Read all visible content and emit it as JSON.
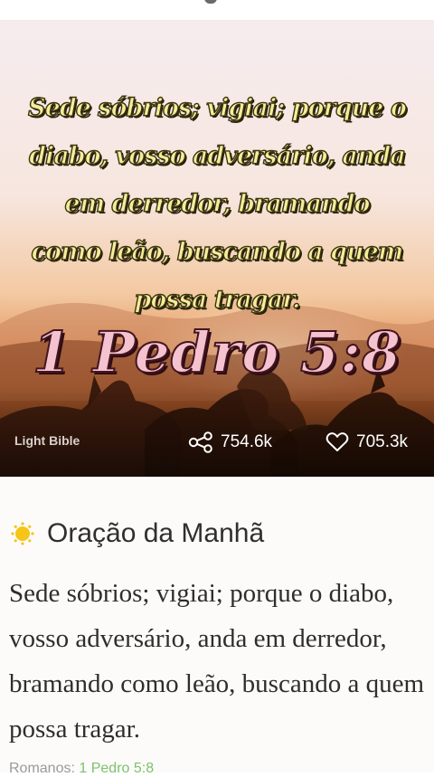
{
  "card": {
    "verse_text": "Sede sóbrios; vigiai; porque o diabo, vosso adversário, anda em derredor, bramando como leão, buscando a quem possa tragar.",
    "reference": "1 Pedro 5:8",
    "credit": "Light Bible",
    "shares": "754.6k",
    "likes": "705.3k",
    "icons": {
      "share": "share-icon",
      "like": "heart-icon"
    }
  },
  "section": {
    "icon": "sun-icon",
    "title": "Oração da Manhã",
    "text": "Sede sóbrios; vigiai; porque o diabo, vosso adversário, anda em derredor, bramando como leão, buscando a quem possa tragar.",
    "source_label": "Romanos:",
    "source_link": "1 Pedro 5:8"
  },
  "colors": {
    "verse_fill": "#f6ed9b",
    "reference_fill": "#f5c3cf",
    "link": "#7cc36a",
    "sun": "#f5c518"
  }
}
